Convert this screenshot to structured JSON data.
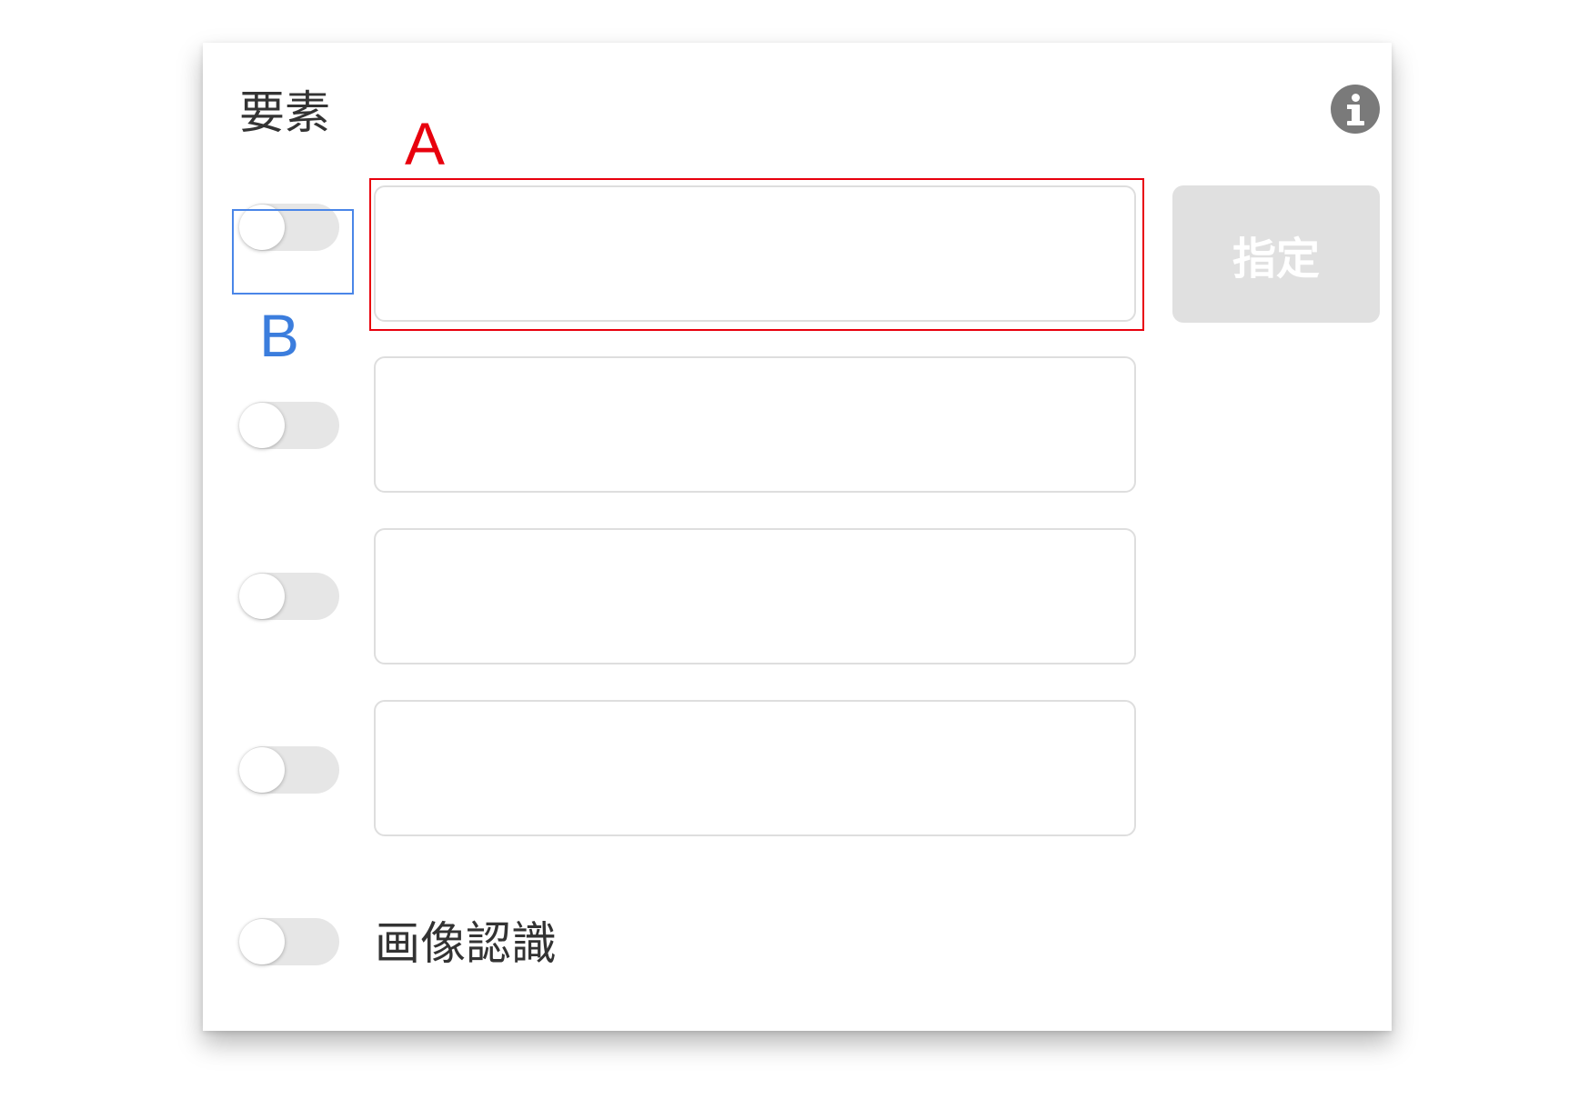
{
  "panel": {
    "title": "要素",
    "info_icon": "info-icon",
    "designate_button_label": "指定",
    "designate_button_enabled": false,
    "rows": [
      {
        "toggle_on": false,
        "value": "",
        "placeholder": ""
      },
      {
        "toggle_on": false,
        "value": "",
        "placeholder": ""
      },
      {
        "toggle_on": false,
        "value": "",
        "placeholder": ""
      },
      {
        "toggle_on": false,
        "value": "",
        "placeholder": ""
      }
    ],
    "image_recognition": {
      "label": "画像認識",
      "toggle_on": false
    }
  },
  "annotations": {
    "a_label": "A",
    "a_color": "#e8000d",
    "b_label": "B",
    "b_color": "#4a86e8"
  }
}
